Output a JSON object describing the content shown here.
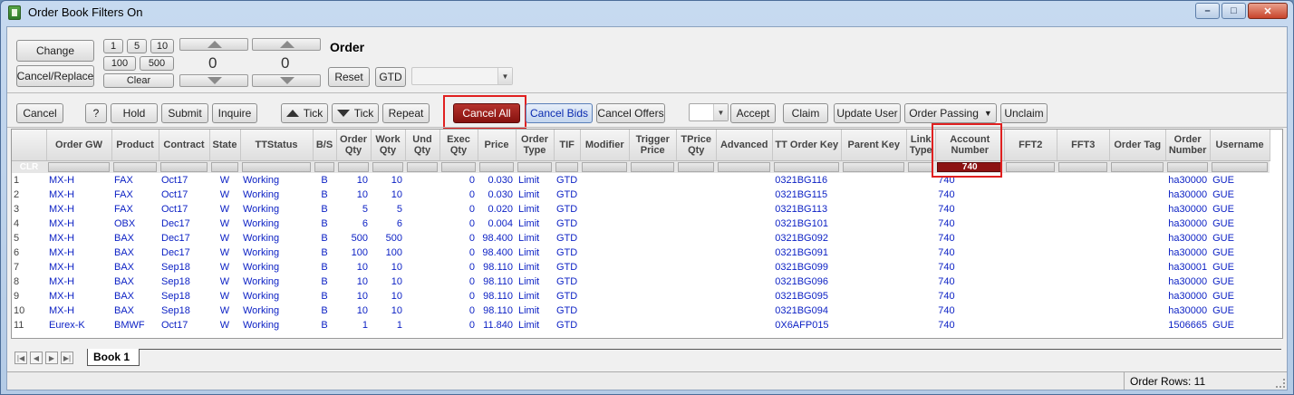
{
  "window": {
    "title": "Order Book Filters On",
    "minimize": "–",
    "maximize": "□",
    "close": "✕"
  },
  "toolbar1": {
    "change": "Change",
    "cancel_replace": "Cancel/Replace",
    "qty_1": "1",
    "qty_5": "5",
    "qty_10": "10",
    "qty_100": "100",
    "qty_500": "500",
    "clear": "Clear",
    "spin1_value": "0",
    "spin2_value": "0",
    "order_label": "Order",
    "reset": "Reset",
    "gtd": "GTD",
    "tif_combo_value": ""
  },
  "toolbar2": {
    "cancel": "Cancel",
    "help": "?",
    "hold": "Hold",
    "submit": "Submit",
    "inquire": "Inquire",
    "tick_up": "Tick",
    "tick_down": "Tick",
    "repeat": "Repeat",
    "cancel_all": "Cancel All",
    "cancel_bids": "Cancel Bids",
    "cancel_offers": "Cancel Offers",
    "accept_combo_value": "",
    "accept": "Accept",
    "claim": "Claim",
    "update_user": "Update User",
    "order_passing": "Order Passing",
    "unclaim": "Unclaim"
  },
  "grid": {
    "columns": [
      "Order GW",
      "Product",
      "Contract",
      "State",
      "TTStatus",
      "B/S",
      "Order Qty",
      "Work Qty",
      "Und Qty",
      "Exec Qty",
      "Price",
      "Order Type",
      "TIF",
      "Modifier",
      "Trigger Price",
      "TPrice Qty",
      "Advanced",
      "TT Order Key",
      "Parent Key",
      "Link Type",
      "Account Number",
      "FFT2",
      "FFT3",
      "Order Tag",
      "Order Number",
      "Username"
    ],
    "clr_label": "CLR",
    "account_filter": "740",
    "rows": [
      {
        "n": "1",
        "gw": "MX-H",
        "product": "FAX",
        "contract": "Oct17",
        "state": "W",
        "status": "Working",
        "bs": "B",
        "oqty": "10",
        "wqty": "10",
        "uqty": "",
        "eqty": "0",
        "price": "0.030",
        "otype": "Limit",
        "tif": "GTD",
        "key": "0321BG116",
        "acct": "740",
        "onum": "ha30000",
        "user": "GUE"
      },
      {
        "n": "2",
        "gw": "MX-H",
        "product": "FAX",
        "contract": "Oct17",
        "state": "W",
        "status": "Working",
        "bs": "B",
        "oqty": "10",
        "wqty": "10",
        "uqty": "",
        "eqty": "0",
        "price": "0.030",
        "otype": "Limit",
        "tif": "GTD",
        "key": "0321BG115",
        "acct": "740",
        "onum": "ha30000",
        "user": "GUE"
      },
      {
        "n": "3",
        "gw": "MX-H",
        "product": "FAX",
        "contract": "Oct17",
        "state": "W",
        "status": "Working",
        "bs": "B",
        "oqty": "5",
        "wqty": "5",
        "uqty": "",
        "eqty": "0",
        "price": "0.020",
        "otype": "Limit",
        "tif": "GTD",
        "key": "0321BG113",
        "acct": "740",
        "onum": "ha30000",
        "user": "GUE"
      },
      {
        "n": "4",
        "gw": "MX-H",
        "product": "OBX",
        "contract": "Dec17",
        "state": "W",
        "status": "Working",
        "bs": "B",
        "oqty": "6",
        "wqty": "6",
        "uqty": "",
        "eqty": "0",
        "price": "0.004",
        "otype": "Limit",
        "tif": "GTD",
        "key": "0321BG101",
        "acct": "740",
        "onum": "ha30000",
        "user": "GUE"
      },
      {
        "n": "5",
        "gw": "MX-H",
        "product": "BAX",
        "contract": "Dec17",
        "state": "W",
        "status": "Working",
        "bs": "B",
        "oqty": "500",
        "wqty": "500",
        "uqty": "",
        "eqty": "0",
        "price": "98.400",
        "otype": "Limit",
        "tif": "GTD",
        "key": "0321BG092",
        "acct": "740",
        "onum": "ha30000",
        "user": "GUE"
      },
      {
        "n": "6",
        "gw": "MX-H",
        "product": "BAX",
        "contract": "Dec17",
        "state": "W",
        "status": "Working",
        "bs": "B",
        "oqty": "100",
        "wqty": "100",
        "uqty": "",
        "eqty": "0",
        "price": "98.400",
        "otype": "Limit",
        "tif": "GTD",
        "key": "0321BG091",
        "acct": "740",
        "onum": "ha30000",
        "user": "GUE"
      },
      {
        "n": "7",
        "gw": "MX-H",
        "product": "BAX",
        "contract": "Sep18",
        "state": "W",
        "status": "Working",
        "bs": "B",
        "oqty": "10",
        "wqty": "10",
        "uqty": "",
        "eqty": "0",
        "price": "98.110",
        "otype": "Limit",
        "tif": "GTD",
        "key": "0321BG099",
        "acct": "740",
        "onum": "ha30001",
        "user": "GUE"
      },
      {
        "n": "8",
        "gw": "MX-H",
        "product": "BAX",
        "contract": "Sep18",
        "state": "W",
        "status": "Working",
        "bs": "B",
        "oqty": "10",
        "wqty": "10",
        "uqty": "",
        "eqty": "0",
        "price": "98.110",
        "otype": "Limit",
        "tif": "GTD",
        "key": "0321BG096",
        "acct": "740",
        "onum": "ha30000",
        "user": "GUE"
      },
      {
        "n": "9",
        "gw": "MX-H",
        "product": "BAX",
        "contract": "Sep18",
        "state": "W",
        "status": "Working",
        "bs": "B",
        "oqty": "10",
        "wqty": "10",
        "uqty": "",
        "eqty": "0",
        "price": "98.110",
        "otype": "Limit",
        "tif": "GTD",
        "key": "0321BG095",
        "acct": "740",
        "onum": "ha30000",
        "user": "GUE"
      },
      {
        "n": "10",
        "gw": "MX-H",
        "product": "BAX",
        "contract": "Sep18",
        "state": "W",
        "status": "Working",
        "bs": "B",
        "oqty": "10",
        "wqty": "10",
        "uqty": "",
        "eqty": "0",
        "price": "98.110",
        "otype": "Limit",
        "tif": "GTD",
        "key": "0321BG094",
        "acct": "740",
        "onum": "ha30000",
        "user": "GUE"
      },
      {
        "n": "11",
        "gw": "Eurex-K",
        "product": "BMWF",
        "contract": "Oct17",
        "state": "W",
        "status": "Working",
        "bs": "B",
        "oqty": "1",
        "wqty": "1",
        "uqty": "",
        "eqty": "0",
        "price": "11.840",
        "otype": "Limit",
        "tif": "GTD",
        "key": "0X6AFP015",
        "acct": "740",
        "onum": "1506665",
        "user": "GUE"
      }
    ]
  },
  "tabs": {
    "book1": "Book 1"
  },
  "status": {
    "rows": "Order Rows: 11"
  },
  "colors": {
    "accent_red": "#86120f",
    "link_blue": "#0a1fc4",
    "highlight": "#e02020"
  }
}
